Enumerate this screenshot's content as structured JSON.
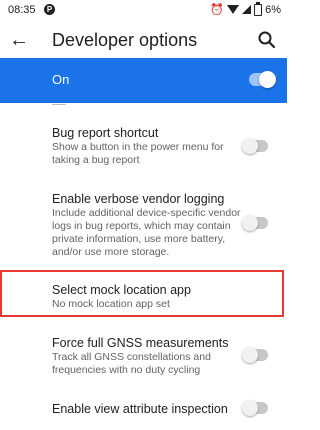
{
  "status_bar": {
    "time": "08:35",
    "notification_icon": "p-badge",
    "battery": "6%"
  },
  "app_bar": {
    "title": "Developer options",
    "back_icon": "arrow-back-icon",
    "search_icon": "search-icon"
  },
  "master": {
    "label": "On",
    "enabled": true
  },
  "items": [
    {
      "title": "Bug report shortcut",
      "summary": "Show a button in the power menu for taking a bug report",
      "toggle": false
    },
    {
      "title": "Enable verbose vendor logging",
      "summary": "Include additional device-specific vendor logs in bug reports, which may contain private information, use more battery, and/or use more storage.",
      "toggle": false
    },
    {
      "title": "Select mock location app",
      "summary": "No mock location app set",
      "highlighted": true
    },
    {
      "title": "Force full GNSS measurements",
      "summary": "Track all GNSS constellations and frequencies with no duty cycling",
      "toggle": false
    },
    {
      "title": "Enable view attribute inspection",
      "toggle": false
    }
  ],
  "colors": {
    "accent": "#1a73e8",
    "highlight": "#e53935"
  }
}
